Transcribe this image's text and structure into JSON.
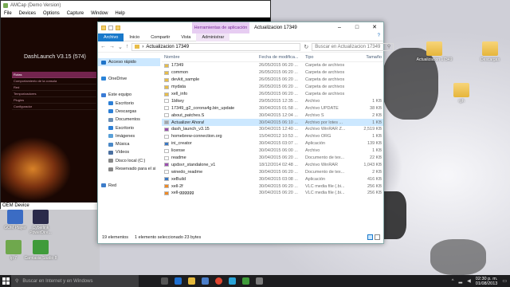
{
  "amcap": {
    "title": "AMCap (Demo Version)",
    "menu": [
      "File",
      "Devices",
      "Options",
      "Capture",
      "Window",
      "Help"
    ],
    "dash_title": "DashLaunch V3.15 (574)",
    "dash_menu": [
      "Rutas",
      "Comportamiento de la consola",
      "Red",
      "Temporizadores",
      "Plugins",
      "Configurador"
    ],
    "status": "OEM Device"
  },
  "explorer": {
    "context_tab": "Herramientas de aplicación",
    "title": "Actualizacion 17349",
    "tabs": [
      "Archivo",
      "Inicio",
      "Compartir",
      "Vista",
      "Administrar"
    ],
    "address": "Actualizacion 17349",
    "search_placeholder": "Buscar en Actualizacion 17349",
    "nav": [
      {
        "label": "Acceso rápido",
        "color": "#1e73c8",
        "sel": true
      },
      {
        "label": "",
        "color": ""
      },
      {
        "label": "OneDrive",
        "color": "#2b84d8"
      },
      {
        "label": "",
        "color": ""
      },
      {
        "label": "Este equipo",
        "color": "#3a7bd5"
      },
      {
        "label": "Escritorio",
        "color": "#2c7fd6"
      },
      {
        "label": "Descargas",
        "color": "#2c7fd6"
      },
      {
        "label": "Documentos",
        "color": "#6b8fb5"
      },
      {
        "label": "Escritorio",
        "color": "#2c7fd6"
      },
      {
        "label": "Imágenes",
        "color": "#59a0d8"
      },
      {
        "label": "Música",
        "color": "#4a88c7"
      },
      {
        "label": "Vídeos",
        "color": "#4a6fa0"
      },
      {
        "label": "Disco local (C:)",
        "color": "#888888"
      },
      {
        "label": "Reservado para el si",
        "color": "#888888"
      },
      {
        "label": "",
        "color": ""
      },
      {
        "label": "Red",
        "color": "#3d7cc9"
      }
    ],
    "columns": [
      "Nombre",
      "Fecha de modifica...",
      "Tipo",
      "Tamaño"
    ],
    "files": [
      {
        "n": "17349",
        "d": "26/05/2015 06:20 ...",
        "t": "Carpeta de archivos",
        "s": "",
        "c": "#e8bd48"
      },
      {
        "n": "common",
        "d": "26/05/2015 06:20 ...",
        "t": "Carpeta de archivos",
        "s": "",
        "c": "#e8bd48"
      },
      {
        "n": "devkit_sample",
        "d": "26/05/2015 06:20 ...",
        "t": "Carpeta de archivos",
        "s": "",
        "c": "#e8bd48"
      },
      {
        "n": "mydata",
        "d": "26/05/2015 06:20 ...",
        "t": "Carpeta de archivos",
        "s": "",
        "c": "#e8bd48"
      },
      {
        "n": "xell_info",
        "d": "26/05/2015 06:20 ...",
        "t": "Carpeta de archivos",
        "s": "",
        "c": "#e8bd48"
      },
      {
        "n": "1blkey",
        "d": "29/05/2015 12:35 ...",
        "t": "Archivo",
        "s": "1 KB",
        "c": "#ffffff"
      },
      {
        "n": "17349_g2_corona4g.bin_update",
        "d": "30/04/2015 01:58 ...",
        "t": "Archivo UPDATE",
        "s": "38 KB",
        "c": "#ffffff"
      },
      {
        "n": "about_patches.S",
        "d": "30/04/2015 12:04 ...",
        "t": "Archivo S",
        "s": "2 KB",
        "c": "#ffffff"
      },
      {
        "n": "Actualizer Ahora!",
        "d": "30/04/2015 06:10 ...",
        "t": "Archivo por lotes ...",
        "s": "1 KB",
        "c": "#9aa6b0",
        "sel": true
      },
      {
        "n": "dash_launch_v3.15",
        "d": "30/04/2015 12:40 ...",
        "t": "Archivo WinRAR Z...",
        "s": "2,519 KB",
        "c": "#9b4fb0"
      },
      {
        "n": "homebrew-connection.org",
        "d": "15/04/2012 10:53 ...",
        "t": "Archivo ORG",
        "s": "1 KB",
        "c": "#ffffff"
      },
      {
        "n": "ini_creator",
        "d": "30/04/2015 03:07 ...",
        "t": "Aplicación",
        "s": "139 KB",
        "c": "#3a78c4"
      },
      {
        "n": "license",
        "d": "30/04/2015 06:00 ...",
        "t": "Archivo",
        "s": "1 KB",
        "c": "#ffffff"
      },
      {
        "n": "readme",
        "d": "30/04/2015 06:20 ...",
        "t": "Documento de tex...",
        "s": "22 KB",
        "c": "#ffffff"
      },
      {
        "n": "updsvr_standalone_v1",
        "d": "18/12/2014 02:48 ...",
        "t": "Archivo WinRAR",
        "s": "1,043 KB",
        "c": "#9b4fb0"
      },
      {
        "n": "winedo_readme",
        "d": "30/04/2015 06:20 ...",
        "t": "Documento de tex...",
        "s": "2 KB",
        "c": "#ffffff"
      },
      {
        "n": "xeBuild",
        "d": "30/04/2015 03:08 ...",
        "t": "Aplicación",
        "s": "416 KB",
        "c": "#3a78c4"
      },
      {
        "n": "xell-2f",
        "d": "30/04/2015 06:20 ...",
        "t": "VLC media file (.bi...",
        "s": "256 KB",
        "c": "#f08a24"
      },
      {
        "n": "xell-gggggg",
        "d": "30/04/2015 06:20 ...",
        "t": "VLC media file (.bi...",
        "s": "256 KB",
        "c": "#f08a24"
      }
    ],
    "status_count": "19 elementos",
    "status_sel": "1 elemento seleccionado 23 bytes"
  },
  "desktop": [
    {
      "label": "Actualizacion 17349",
      "kind": "folder"
    },
    {
      "label": "Descargas",
      "kind": "folder"
    },
    {
      "label": "rgh",
      "kind": "folder"
    },
    {
      "label": "GOM Player",
      "kind": "app"
    },
    {
      "label": "Cyberlink PowerDire...",
      "kind": "app"
    },
    {
      "label": "ip 7",
      "kind": "app"
    },
    {
      "label": "Camtasia Studio 8",
      "kind": "app"
    }
  ],
  "taskbar": {
    "search": "Buscar en Internet y en Windows",
    "time": "02:30 p. m.",
    "date": "01/08/2013"
  }
}
